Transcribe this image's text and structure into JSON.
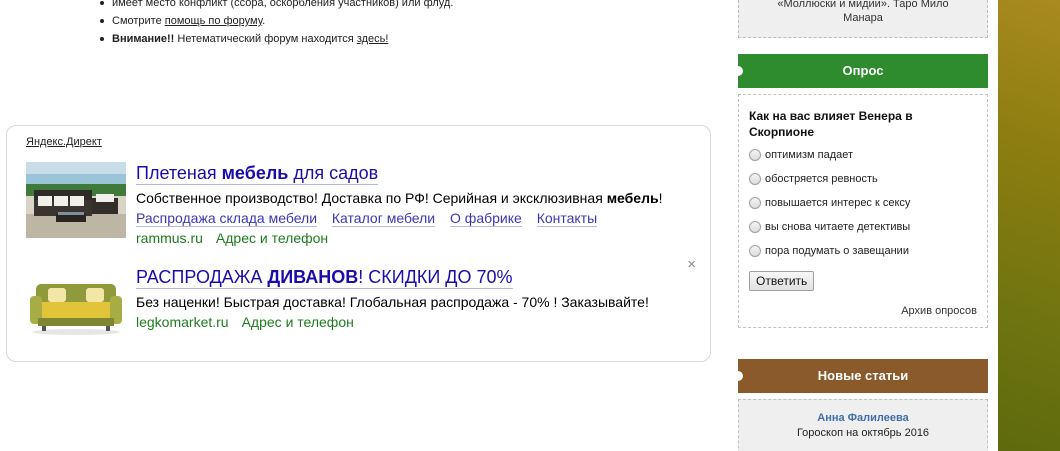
{
  "rules": {
    "item1_text": "имеет место конфликт (ссора, оскорбления участников) или флуд.",
    "item2_prefix": "Смотрите ",
    "item2_link": "помощь по форуму",
    "item2_suffix": ".",
    "item3_bold": "Внимание!!",
    "item3_text": " Нетематический форум находится ",
    "item3_link": "здесь!"
  },
  "ad": {
    "source_label": "Яндекс.Директ",
    "close_glyph": "×",
    "items": [
      {
        "title_pre": "Плетеная ",
        "title_bold": "мебель",
        "title_post": " для садов",
        "text_pre": "Собственное производство! Доставка по РФ! Серийная и эксклюзивная ",
        "text_bold": "мебель",
        "text_post": "!",
        "links": [
          "Распродажа склада мебели",
          "Каталог мебели",
          "О фабрике",
          "Контакты"
        ],
        "domain": "rammus.ru",
        "contact": "Адрес и телефон"
      },
      {
        "title_pre": "РАСПРОДАЖА ",
        "title_bold": "ДИВАНОВ",
        "title_post": "! СКИДКИ ДО 70%",
        "text_pre": "Без наценки! Быстрая доставка! Глобальная распродажа - 70% ! Заказывайте!",
        "text_bold": "",
        "text_post": "",
        "domain": "legkomarket.ru",
        "contact": "Адрес и телефон"
      }
    ]
  },
  "sidebar": {
    "top_box_line1": "«Моллюски и мидии». Таро Мило",
    "top_box_line2": "Манара",
    "poll": {
      "header": "Опрос",
      "question": "Как на вас влияет Венера в Скорпионе",
      "options": [
        "оптимизм падает",
        "обостряется ревность",
        "повышается интерес к сексу",
        "вы снова читаете детективы",
        "пора подумать о завещании"
      ],
      "submit_label": "Ответить",
      "archive_label": "Архив опросов"
    },
    "articles": {
      "header": "Новые статьи",
      "author": "Анна Фалилеева",
      "title": "Гороскоп на октябрь 2016"
    }
  },
  "colors": {
    "poll_header": "#2e8b2e",
    "articles_header": "#8b5a2b",
    "ad_link": "#1a0dab",
    "ad_domain": "#1e7d1e",
    "author_link": "#3f6fa6"
  }
}
